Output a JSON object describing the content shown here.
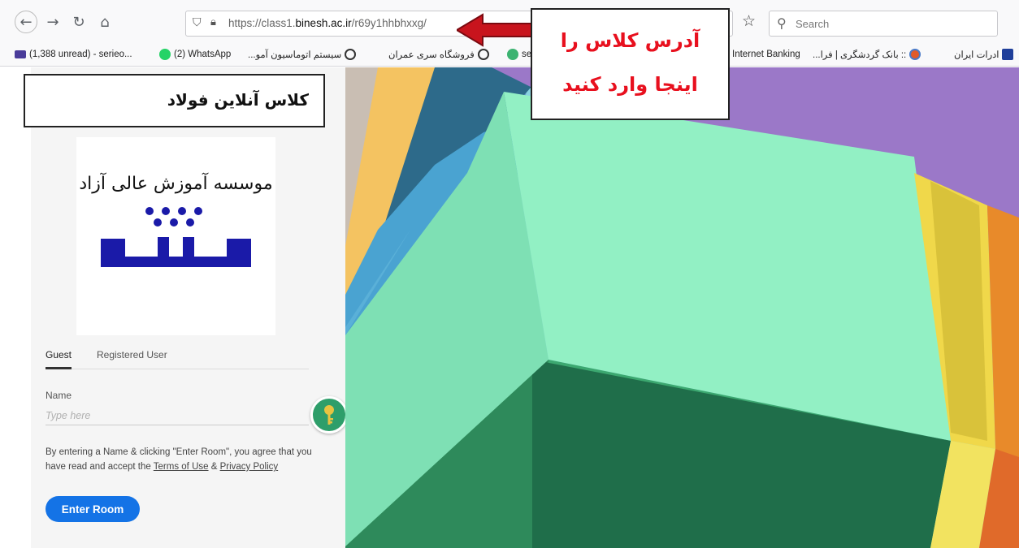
{
  "browser": {
    "url_prefix": "https://class1.",
    "url_domain": "binesh.ac.ir",
    "url_path": "/r69y1hhbhxxg/",
    "search_placeholder": "Search"
  },
  "bookmarks": [
    {
      "label": "(1,388 unread) - serieo...",
      "icon": "mail-icon"
    },
    {
      "label": "(2) WhatsApp",
      "icon": "whatsapp-icon"
    },
    {
      "label": "سیستم اتوماسیون آمو...",
      "icon": "globe-icon"
    },
    {
      "label": "فروشگاه سری عمران",
      "icon": "globe-icon"
    },
    {
      "label": "se",
      "icon": "green-icon"
    },
    {
      "label": "Internet Banking",
      "icon": "bank-icon"
    },
    {
      "label": ":: بانک گردشگری | فرا...",
      "icon": "bank-icon"
    },
    {
      "label": "ادرات ایران",
      "icon": "h-icon"
    }
  ],
  "annotation": {
    "title": "کلاس آنلاین فولاد",
    "callout_line1": "آدرس کلاس را",
    "callout_line2": "اینجا وارد کنید",
    "callout_color": "#e8101e"
  },
  "login": {
    "logo_text": "موسسه آموزش عالی آزاد",
    "tab_guest": "Guest",
    "tab_registered": "Registered User",
    "name_label": "Name",
    "name_placeholder": "Type here",
    "terms_prefix": "By entering a Name & clicking \"Enter Room\", you agree that you have read and accept the ",
    "terms_link": "Terms of Use",
    "terms_and": " & ",
    "privacy_link": "Privacy Policy",
    "enter_button": "Enter Room",
    "button_color": "#1473e6"
  }
}
